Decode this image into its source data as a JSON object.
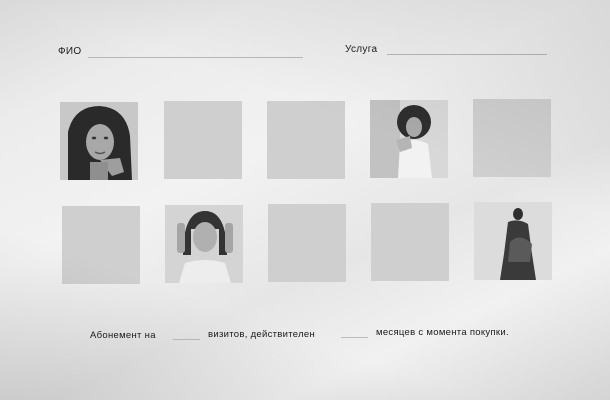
{
  "form": {
    "name_label": "ФИО",
    "service_label": "Услуга"
  },
  "stamps": {
    "row1": [
      "photo",
      "empty",
      "empty",
      "photo",
      "empty"
    ],
    "row2": [
      "empty",
      "photo",
      "empty",
      "empty",
      "photo"
    ]
  },
  "footer": {
    "part1": "Абонемент на",
    "part2": "визитов,  действителен",
    "part3": "месяцев с момента покупки."
  }
}
